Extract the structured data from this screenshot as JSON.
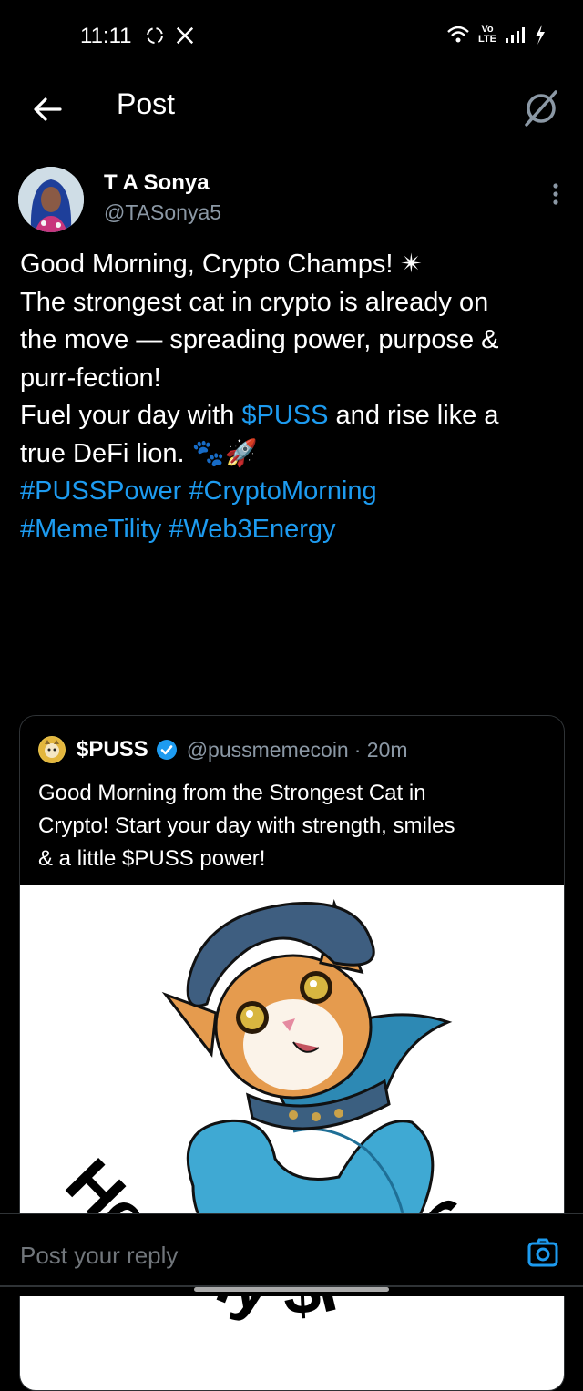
{
  "status_bar": {
    "time": "11:11",
    "network_label": "Vo LTE"
  },
  "header": {
    "title": "Post"
  },
  "post": {
    "author_name": "T A Sonya",
    "author_handle": "@TASonya5",
    "lines": [
      [
        {
          "t": "Good Morning, Crypto Champs! "
        },
        {
          "t": "✴",
          "emoji": true
        }
      ],
      [
        {
          "t": "The strongest cat in crypto is already on"
        }
      ],
      [
        {
          "t": "the move — spreading power, purpose &"
        }
      ],
      [
        {
          "t": "purr-fection!"
        }
      ],
      [
        {
          "t": "Fuel your day with "
        },
        {
          "t": "$PUSS",
          "link": true
        },
        {
          "t": " and rise like a"
        }
      ],
      [
        {
          "t": "true DeFi lion. "
        },
        {
          "t": "🐾🚀",
          "emoji": true
        }
      ],
      [
        {
          "t": "#PUSSPower",
          "link": true
        },
        {
          "t": " "
        },
        {
          "t": "#CryptoMorning",
          "link": true
        }
      ],
      [
        {
          "t": "#MemeTility",
          "link": true
        },
        {
          "t": " "
        },
        {
          "t": "#Web3Energy",
          "link": true
        }
      ]
    ]
  },
  "quote": {
    "name": "$PUSS",
    "handle": "@pussmemecoin",
    "time": "· 20m",
    "text_lines": [
      "Good Morning from the Strongest Cat in",
      "Crypto! Start your day with strength, smiles",
      "& a little $PUSS power!"
    ],
    "image_caption": "Healthy $PUSS"
  },
  "reply": {
    "placeholder": "Post your reply"
  },
  "colors": {
    "accent": "#1d9bf0",
    "background": "#000000",
    "muted": "#8b98a5"
  }
}
